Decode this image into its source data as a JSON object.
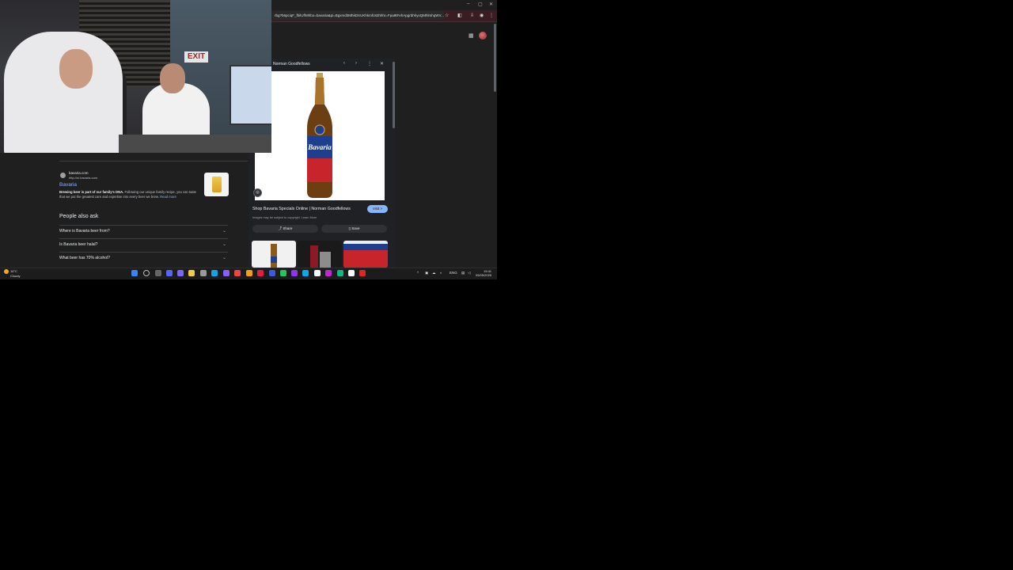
{
  "browser": {
    "url": "rbg?b6pciqF_fbilUfh8hbo=bavaria&pi=Bgxmd3MhkDXUKhkmfc82hhhr=Fpa9tFehApgrbhhyxQMhlmhqWV...",
    "window_controls": [
      "–",
      "▢",
      "✕"
    ]
  },
  "search_result": {
    "site_name": "bavaria.com",
    "site_url": "http://nl.bavaria.com",
    "title": "Bavaria",
    "snippet_bold": "Brewing beer is part of our family's DNA.",
    "snippet_rest": "Following our unique family recipe, you can taste that we put the greatest care and expertise into every beer we brew.",
    "read_more": "Read more"
  },
  "people_also_ask": {
    "title": "People also ask",
    "questions": [
      "Where is Bavaria beer from?",
      "Is Bavaria beer halal?",
      "What beer has 70% alcohol?"
    ]
  },
  "panel": {
    "header": "Norman Goodfellows",
    "image_title": "Shop Bavaria Specials Online | Norman Goodfellows",
    "visit_label": "Visit >",
    "copyright": "Images may be subject to copyright. Learn More",
    "share_label": "Share",
    "save_label": "Save",
    "bottle_brand": "Bavaria"
  },
  "taskbar": {
    "weather_temp": "16°C",
    "weather_desc": "Cloudy",
    "language": "ENG",
    "time": "19:41",
    "date": "05/05/2025"
  },
  "webcam": {
    "exit_sign": "EXIT"
  }
}
